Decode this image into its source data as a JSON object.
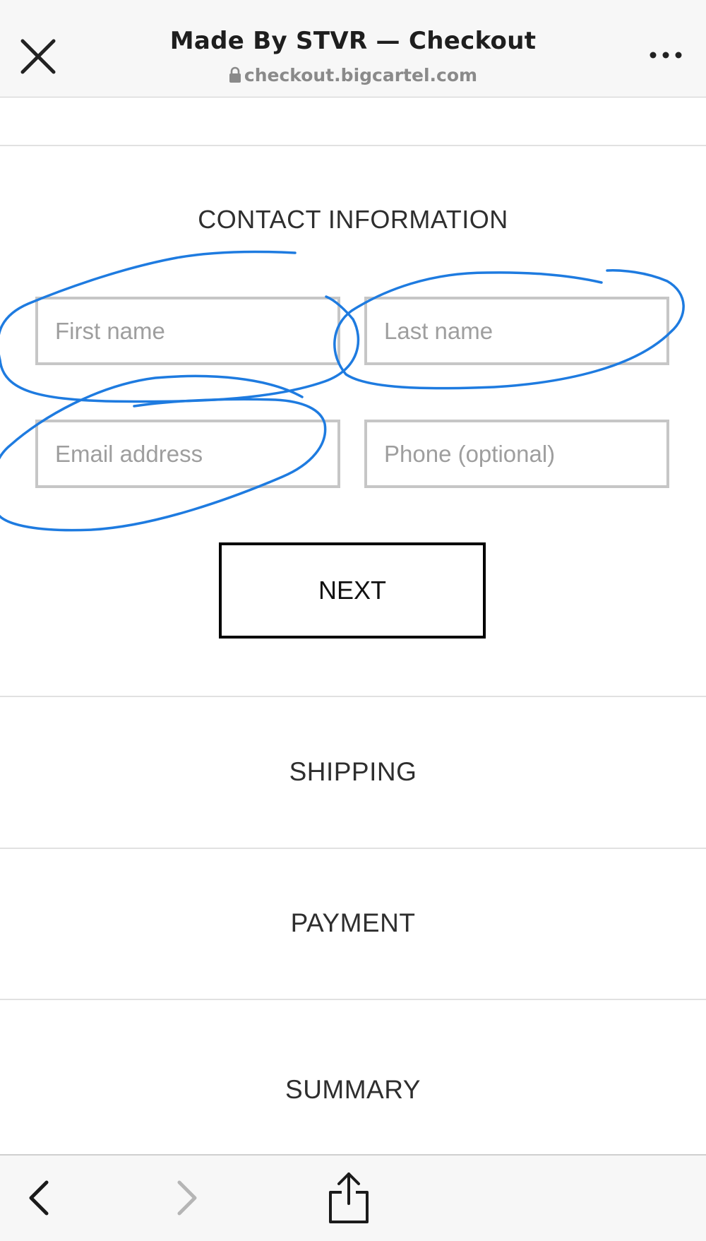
{
  "browser": {
    "title": "Made By STVR — Checkout",
    "url": "checkout.bigcartel.com",
    "icons": {
      "close": "close-icon",
      "lock": "lock-icon",
      "more": "more-icon",
      "back": "chevron-left-icon",
      "forward": "chevron-right-icon",
      "share": "share-icon"
    }
  },
  "contact": {
    "heading": "CONTACT INFORMATION",
    "first_name": {
      "placeholder": "First name",
      "value": ""
    },
    "last_name": {
      "placeholder": "Last name",
      "value": ""
    },
    "email": {
      "placeholder": "Email address",
      "value": ""
    },
    "phone": {
      "placeholder": "Phone (optional)",
      "value": ""
    },
    "next_label": "NEXT"
  },
  "steps": {
    "shipping": "SHIPPING",
    "payment": "PAYMENT",
    "summary": "SUMMARY"
  },
  "colors": {
    "annotation": "#1e7be0",
    "field_border": "#c6c6c6",
    "button_border": "#000000"
  }
}
